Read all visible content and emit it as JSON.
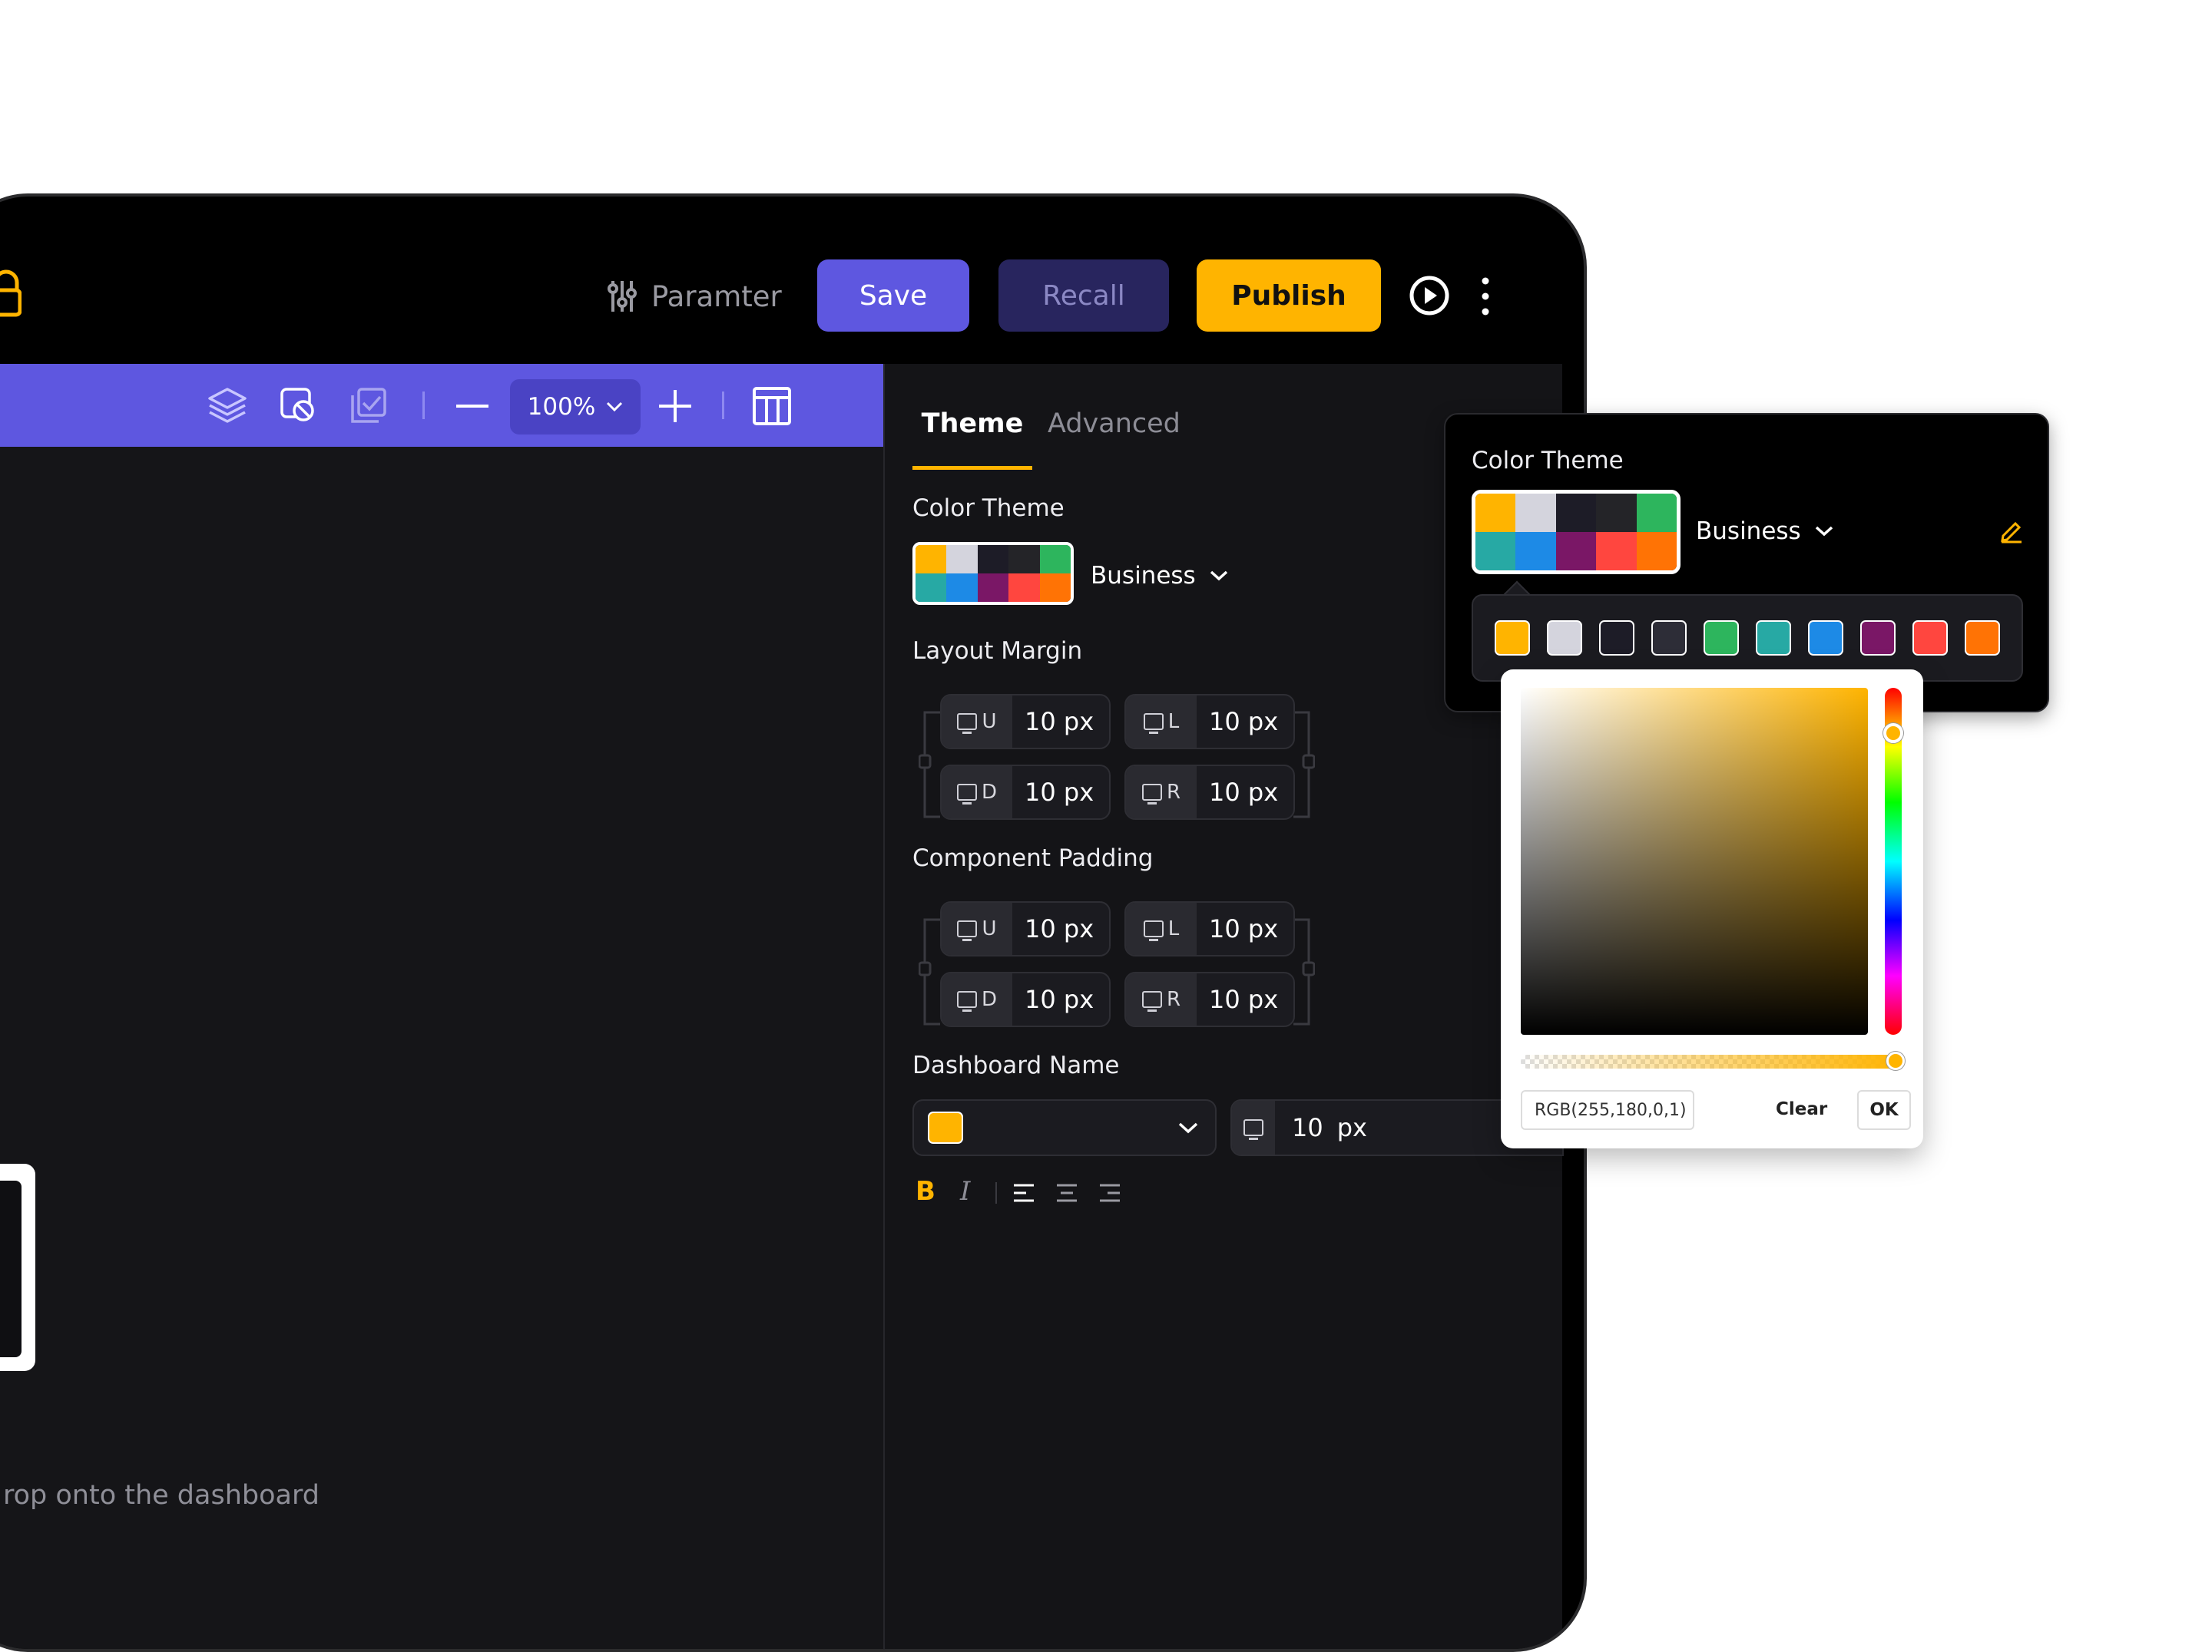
{
  "topbar": {
    "parameter_label": "Paramter",
    "save_label": "Save",
    "recall_label": "Recall",
    "publish_label": "Publish"
  },
  "toolbar": {
    "zoom_value": "100%"
  },
  "canvas": {
    "hint_text": "rop onto the dashboard"
  },
  "panel": {
    "tabs": [
      {
        "label": "Theme",
        "active": true
      },
      {
        "label": "Advanced",
        "active": false
      }
    ],
    "color_theme": {
      "label": "Color Theme",
      "selected": "Business",
      "swatches": [
        "#FFB400",
        "#D4D4DD",
        "#1D1C27",
        "#242428",
        "#2DB55D",
        "#27A9A4",
        "#1D8AE6",
        "#7A1766",
        "#FF463F",
        "#FF7305"
      ]
    },
    "layout_margin": {
      "label": "Layout Margin",
      "fields": [
        {
          "side": "U",
          "value": "10 px"
        },
        {
          "side": "L",
          "value": "10 px"
        },
        {
          "side": "D",
          "value": "10 px"
        },
        {
          "side": "R",
          "value": "10 px"
        }
      ]
    },
    "component_padding": {
      "label": "Component Padding",
      "fields": [
        {
          "side": "U",
          "value": "10 px"
        },
        {
          "side": "L",
          "value": "10 px"
        },
        {
          "side": "D",
          "value": "10 px"
        },
        {
          "side": "R",
          "value": "10 px"
        }
      ]
    },
    "dashboard_name": {
      "label": "Dashboard Name",
      "color": "#FFB400",
      "size_value": "10",
      "size_unit": "px",
      "format": {
        "bold": "B",
        "italic": "I"
      }
    }
  },
  "popup": {
    "title": "Color Theme",
    "selected": "Business",
    "swatch_row": [
      "#FFB400",
      "#D4D4DD",
      "#1D1C27",
      "#2D2D37",
      "#2DB55D",
      "#27A9A4",
      "#1D8AE6",
      "#7A1766",
      "#FF463F",
      "#FF7305"
    ]
  },
  "picker": {
    "value": "RGB(255,180,0,1)",
    "hue_position": 0.13,
    "alpha": 1,
    "clear_label": "Clear",
    "ok_label": "OK"
  },
  "colors": {
    "accent_purple": "#5E57E0",
    "accent_yellow": "#FFB400",
    "recall_bg": "#28255E"
  }
}
